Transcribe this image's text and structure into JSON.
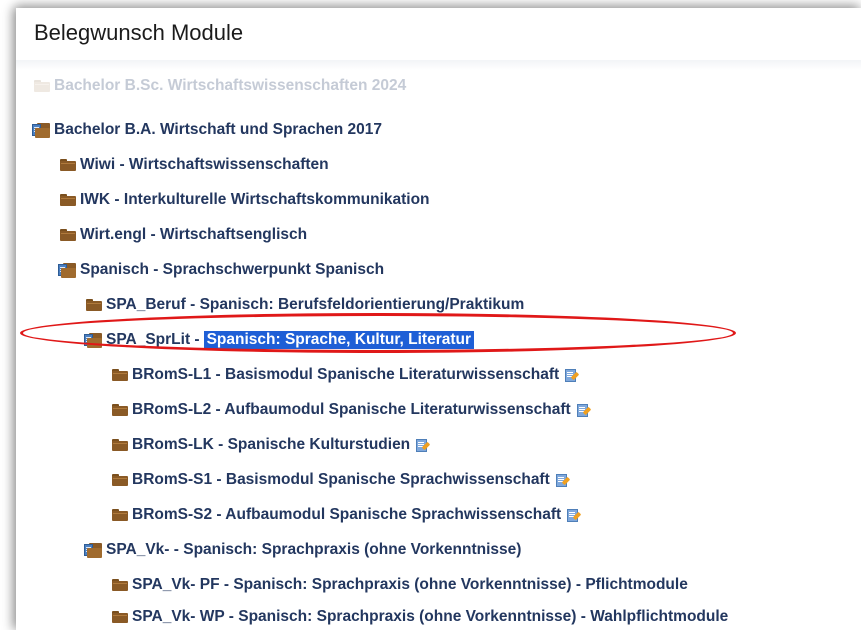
{
  "header": {
    "title": "Belegwunsch Module"
  },
  "tree": [
    {
      "label": "Bachelor B.Sc. Wirtschaftswissenschaften 2024",
      "icon": "folder-icon",
      "faded": true
    },
    {
      "label": "Bachelor B.A. Wirtschaft und Sprachen 2017",
      "icon": "folder-open-icon"
    },
    {
      "label": "Wiwi - Wirtschaftswissenschaften",
      "icon": "folder-icon"
    },
    {
      "label": "IWK - Interkulturelle Wirtschaftskommunikation",
      "icon": "folder-icon"
    },
    {
      "label": "Wirt.engl - Wirtschaftsenglisch",
      "icon": "folder-icon"
    },
    {
      "label": "Spanisch - Sprachschwerpunkt Spanisch",
      "icon": "folder-open-icon"
    },
    {
      "label": "SPA_Beruf - Spanisch: Berufsfeldorientierung/Praktikum",
      "icon": "folder-icon"
    },
    {
      "label_prefix": "SPA_SprLit -",
      "label_selected": "Spanisch: Sprache, Kultur, Literatur",
      "icon": "folder-open-icon",
      "selected": true
    },
    {
      "label": "BRomS-L1 - Basismodul Spanische Literaturwissenschaft",
      "icon": "folder-icon",
      "action_icon": "edit-document-icon"
    },
    {
      "label": "BRomS-L2 - Aufbaumodul Spanische Literaturwissenschaft",
      "icon": "folder-icon",
      "action_icon": "edit-document-icon"
    },
    {
      "label": "BRomS-LK - Spanische Kulturstudien",
      "icon": "folder-icon",
      "action_icon": "edit-document-icon"
    },
    {
      "label": "BRomS-S1 - Basismodul Spanische Sprachwissenschaft",
      "icon": "folder-icon",
      "action_icon": "edit-document-icon"
    },
    {
      "label": "BRomS-S2 - Aufbaumodul Spanische Sprachwissenschaft",
      "icon": "folder-icon",
      "action_icon": "edit-document-icon"
    },
    {
      "label": "SPA_Vk- - Spanisch: Sprachpraxis (ohne Vorkenntnisse)",
      "icon": "folder-open-icon"
    },
    {
      "label": "SPA_Vk- PF - Spanisch: Sprachpraxis (ohne Vorkenntnisse) - Pflichtmodule",
      "icon": "folder-icon"
    },
    {
      "label": "SPA_Vk- WP - Spanisch: Sprachpraxis (ohne Vorkenntnisse) - Wahlpflichtmodule",
      "icon": "folder-icon"
    }
  ],
  "colors": {
    "text": "#23375f",
    "selection": "#1f5fd6",
    "annotation": "#e01818",
    "folder": "#8a5a26"
  }
}
